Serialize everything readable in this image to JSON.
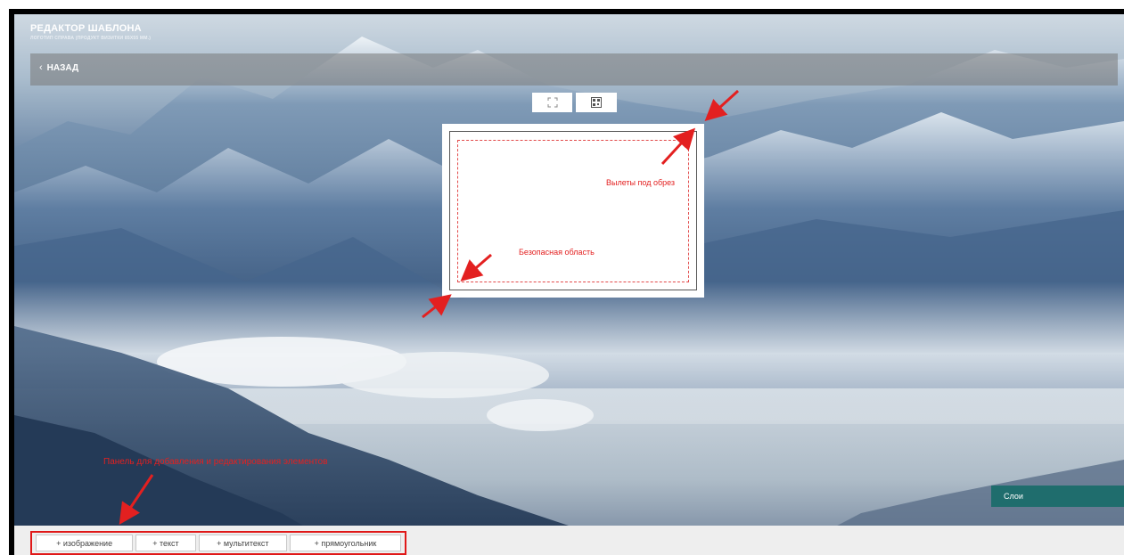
{
  "header": {
    "title": "РЕДАКТОР ШАБЛОНА",
    "subtitle": "ЛОГОТИП СПРАВА (ПРОДУКТ ВИЗИТКИ 85Х55 ММ.)",
    "back_label": "НАЗАД"
  },
  "toolbar": {
    "fit_icon": "expand-icon",
    "qr_icon": "qr-code-icon"
  },
  "annotations": {
    "bleed": "Вылеты под обрез",
    "safe_area": "Безопасная область",
    "panel": "Панель для добавления и редактирования элементов"
  },
  "layers": {
    "label": "Слои"
  },
  "bottom_panel": {
    "add_image": "+ изображение",
    "add_text": "+ текст",
    "add_multitext": "+ мультитекст",
    "add_rectangle": "+ прямоугольник"
  },
  "colors": {
    "annotation": "#e32020",
    "layers_button": "#1f6d6d",
    "panel_outline": "#e01818"
  }
}
